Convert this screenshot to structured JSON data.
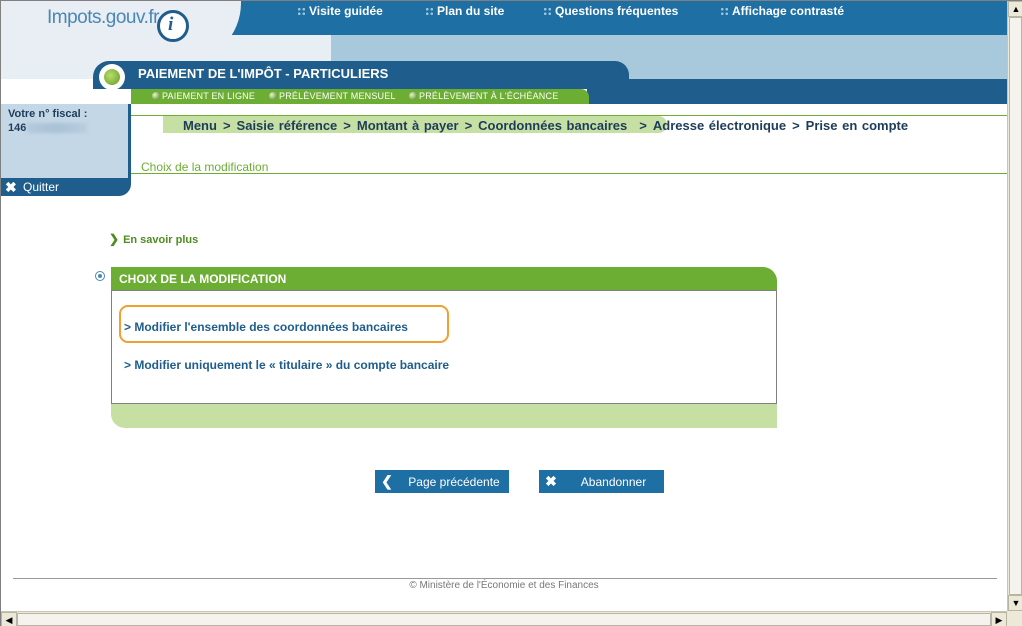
{
  "logo": {
    "text": "Impots.gouv.fr",
    "icon_letter": "i"
  },
  "top_links": [
    "Visite guidée",
    "Plan du site",
    "Questions fréquentes",
    "Affichage contrasté"
  ],
  "title": "PAIEMENT DE L'IMPÔT - PARTICULIERS",
  "subnav": [
    "PAIEMENT EN LIGNE",
    "PRÉLÈVEMENT MENSUEL",
    "PRÉLÈVEMENT À L'ÉCHÉANCE"
  ],
  "left_panel": {
    "fiscal_label": "Votre n° fiscal :",
    "fiscal_value": "146",
    "quit": "Quitter"
  },
  "breadcrumb": {
    "done": [
      "Menu",
      "Saisie référence",
      "Montant à payer",
      "Coordonnées bancaires"
    ],
    "todo": [
      "Adresse électronique",
      "Prise en compte"
    ],
    "separator": ">"
  },
  "section_label": "Choix de la modification",
  "more_link": "En savoir plus",
  "choice_box": {
    "title": "CHOIX DE LA MODIFICATION",
    "options": [
      "> Modifier l'ensemble des coordonnées bancaires",
      "> Modifier uniquement le « titulaire » du compte bancaire"
    ]
  },
  "buttons": {
    "previous": "Page précédente",
    "abort": "Abandonner"
  },
  "footer": "© Ministère de l'Économie et des Finances",
  "colors": {
    "blue": "#1e5d8c",
    "green": "#6cae33",
    "light_green": "#c6e0a3",
    "highlight": "#f0a030"
  }
}
